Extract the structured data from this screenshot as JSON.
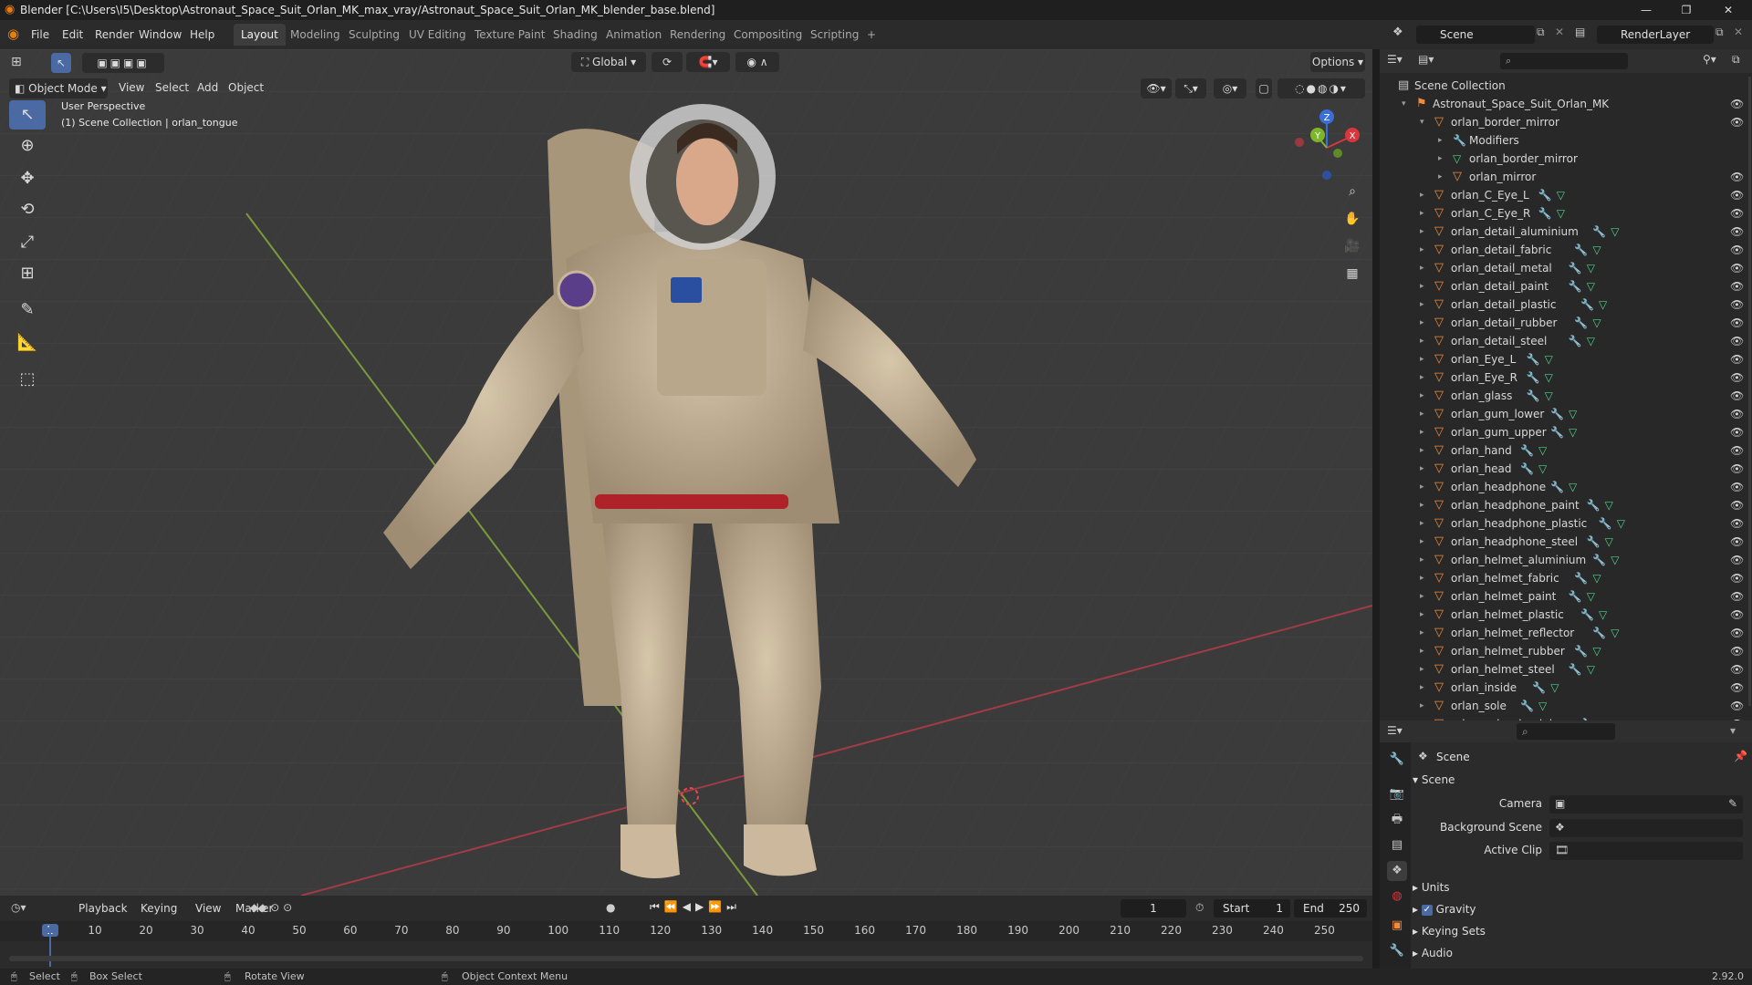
{
  "titlebar": {
    "title": "Blender [C:\\Users\\I5\\Desktop\\Astronaut_Space_Suit_Orlan_MK_max_vray/Astronaut_Space_Suit_Orlan_MK_blender_base.blend]",
    "minimize": "—",
    "restore": "❐",
    "close": "✕"
  },
  "menu": [
    "File",
    "Edit",
    "Render",
    "Window",
    "Help"
  ],
  "workspaces": [
    "Layout",
    "Modeling",
    "Sculpting",
    "UV Editing",
    "Texture Paint",
    "Shading",
    "Animation",
    "Rendering",
    "Compositing",
    "Scripting",
    "+"
  ],
  "scene_field": "Scene",
  "layer_field": "RenderLayer",
  "viewport": {
    "mode": "Object Mode",
    "menus": [
      "View",
      "Select",
      "Add",
      "Object"
    ],
    "orientation": "Global",
    "options": "Options",
    "info_line1": "User Perspective",
    "info_line2": "(1) Scene Collection | orlan_tongue",
    "gizmo": {
      "z": "Z",
      "y": "Y",
      "x": "X"
    }
  },
  "outliner": {
    "root": "Scene Collection",
    "collection": "Astronaut_Space_Suit_Orlan_MK",
    "parent": "orlan_border_mirror",
    "children": [
      "Modifiers",
      "orlan_border_mirror",
      "orlan_mirror"
    ],
    "items": [
      "orlan_C_Eye_L",
      "orlan_C_Eye_R",
      "orlan_detail_aluminium",
      "orlan_detail_fabric",
      "orlan_detail_metal",
      "orlan_detail_paint",
      "orlan_detail_plastic",
      "orlan_detail_rubber",
      "orlan_detail_steel",
      "orlan_Eye_L",
      "orlan_Eye_R",
      "orlan_glass",
      "orlan_gum_lower",
      "orlan_gum_upper",
      "orlan_hand",
      "orlan_head",
      "orlan_headphone",
      "orlan_headphone_paint",
      "orlan_headphone_plastic",
      "orlan_headphone_steel",
      "orlan_helmet_aluminium",
      "orlan_helmet_fabric",
      "orlan_helmet_paint",
      "orlan_helmet_plastic",
      "orlan_helmet_reflector",
      "orlan_helmet_rubber",
      "orlan_helmet_steel",
      "orlan_inside",
      "orlan_sole",
      "orlan_sole_aluminium"
    ]
  },
  "properties": {
    "context": "Scene",
    "panel": "Scene",
    "camera_label": "Camera",
    "background_label": "Background Scene",
    "clip_label": "Active Clip",
    "sections": [
      "Units",
      "Gravity",
      "Keying Sets",
      "Audio"
    ],
    "gravity_checked": true,
    "version": "2.92.0"
  },
  "timeline": {
    "menus": [
      "Playback",
      "Keying",
      "View",
      "Marker"
    ],
    "current_frame": "1",
    "start_label": "Start",
    "start": "1",
    "end_label": "End",
    "end": "250",
    "ticks": [
      "1",
      "10",
      "20",
      "30",
      "40",
      "50",
      "60",
      "70",
      "80",
      "90",
      "100",
      "110",
      "120",
      "130",
      "140",
      "150",
      "160",
      "170",
      "180",
      "190",
      "200",
      "210",
      "220",
      "230",
      "240",
      "250"
    ]
  },
  "statusbar": {
    "select": "Select",
    "box_select": "Box Select",
    "rotate": "Rotate View",
    "context_menu": "Object Context Menu"
  },
  "colors": {
    "accent": "#4b6aa3",
    "object_orange": "#f08a3c",
    "mesh_green": "#4fd08a",
    "modifier_blue": "#7aa2e8",
    "suit": "#c9b79b"
  }
}
